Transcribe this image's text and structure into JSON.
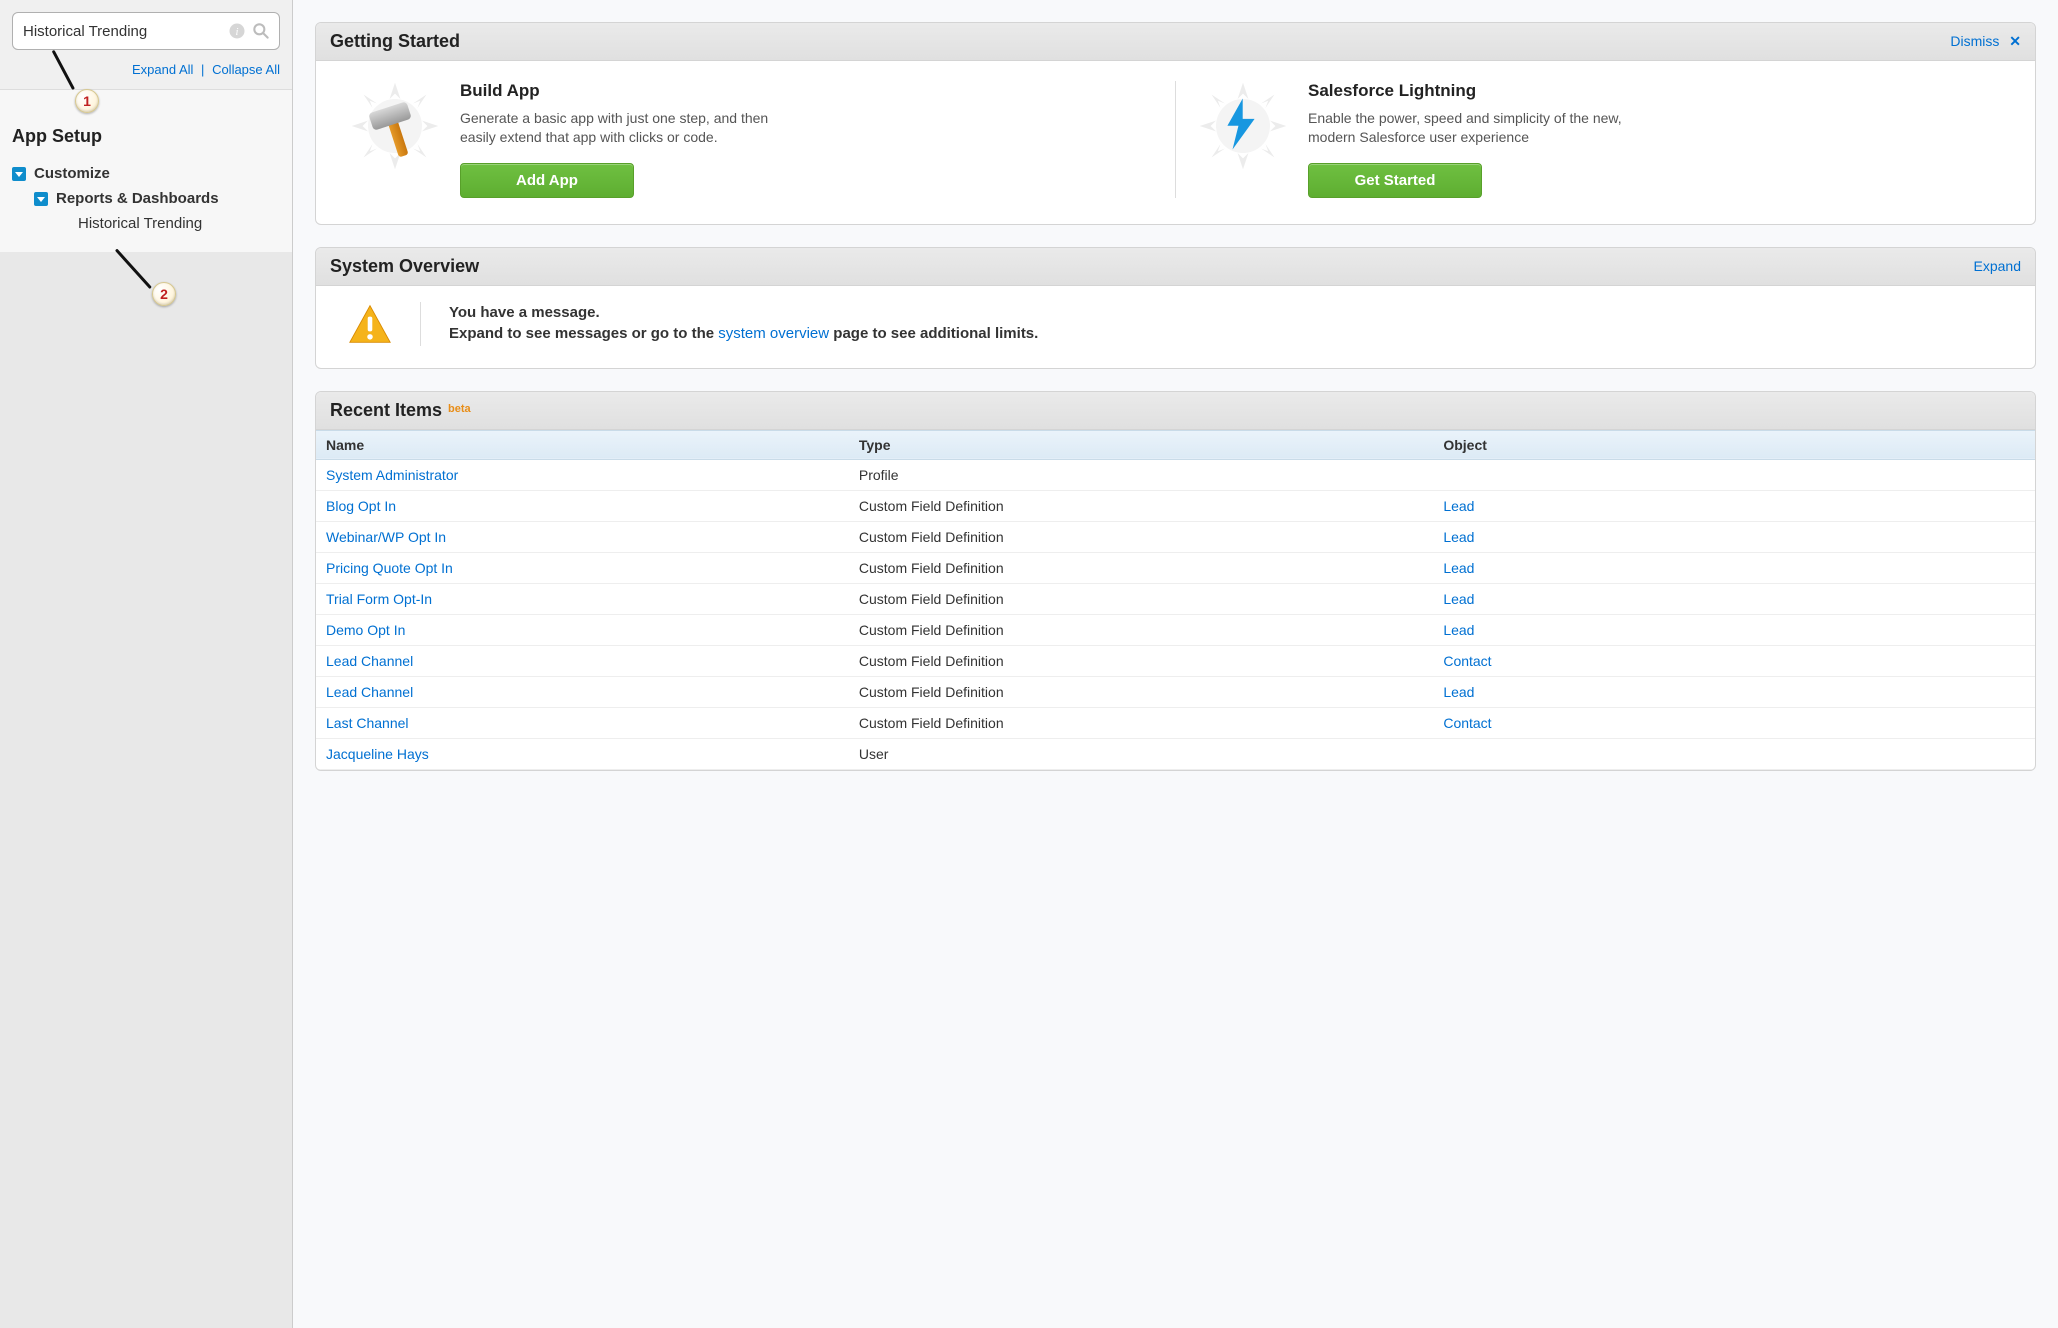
{
  "sidebar": {
    "search_value": "Historical Trending",
    "expand_all": "Expand All",
    "collapse_all": "Collapse All",
    "heading": "App Setup",
    "tree": {
      "l1": "Customize",
      "l2": "Reports & Dashboards",
      "l3": "Historical Trending"
    },
    "annotation1": "1",
    "annotation2": "2"
  },
  "getting_started": {
    "title": "Getting Started",
    "dismiss": "Dismiss",
    "build": {
      "title": "Build App",
      "desc": "Generate a basic app with just one step, and then easily extend that app with clicks or code.",
      "button": "Add App"
    },
    "lightning": {
      "title": "Salesforce Lightning",
      "desc": "Enable the power, speed and simplicity of the new, modern Salesforce user experience",
      "button": "Get Started"
    }
  },
  "system_overview": {
    "title": "System Overview",
    "expand": "Expand",
    "line1": "You have a message.",
    "line2a": "Expand to see messages or go to the ",
    "link": "system overview",
    "line2b": " page to see additional limits."
  },
  "recent": {
    "title": "Recent Items",
    "beta": "beta",
    "headers": {
      "name": "Name",
      "type": "Type",
      "object": "Object"
    },
    "rows": [
      {
        "name": "System Administrator",
        "type": "Profile",
        "object": ""
      },
      {
        "name": "Blog Opt In",
        "type": "Custom Field Definition",
        "object": "Lead"
      },
      {
        "name": "Webinar/WP Opt In",
        "type": "Custom Field Definition",
        "object": "Lead"
      },
      {
        "name": "Pricing Quote Opt In",
        "type": "Custom Field Definition",
        "object": "Lead"
      },
      {
        "name": "Trial Form Opt-In",
        "type": "Custom Field Definition",
        "object": "Lead"
      },
      {
        "name": "Demo Opt In",
        "type": "Custom Field Definition",
        "object": "Lead"
      },
      {
        "name": "Lead Channel",
        "type": "Custom Field Definition",
        "object": "Contact"
      },
      {
        "name": "Lead Channel",
        "type": "Custom Field Definition",
        "object": "Lead"
      },
      {
        "name": "Last Channel",
        "type": "Custom Field Definition",
        "object": "Contact"
      },
      {
        "name": "Jacqueline Hays",
        "type": "User",
        "object": ""
      }
    ]
  }
}
